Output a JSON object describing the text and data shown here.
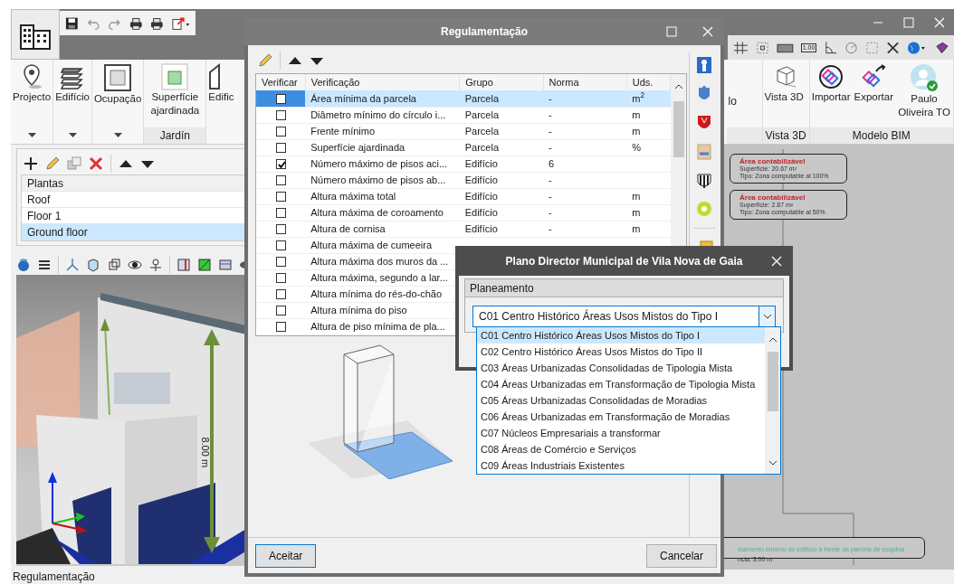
{
  "ribbon": {
    "left_buttons": [
      {
        "label": "Projecto",
        "kind": "dropdown"
      },
      {
        "label": "Edifício",
        "kind": "dropdown"
      },
      {
        "label": "Ocupação",
        "kind": "dropdown"
      },
      {
        "label": "Superfície ajardinada",
        "kind": "grouped",
        "group": "Jardín"
      },
      {
        "label": "Edific",
        "kind": "plain"
      }
    ],
    "partial_label": "lo",
    "right_groups": [
      {
        "label": "Vista 3D",
        "buttons": [
          {
            "label": "Vista 3D"
          }
        ]
      },
      {
        "label": "Modelo BIM",
        "buttons": [
          {
            "label": "Importar"
          },
          {
            "label": "Exportar"
          },
          {
            "label": "Paulo Oliveira TO"
          }
        ]
      }
    ]
  },
  "view_toolbar": {
    "scale_label": "1.00"
  },
  "plantas": {
    "header": "Plantas",
    "rows": [
      {
        "label": "Roof",
        "selected": false
      },
      {
        "label": "Floor 1",
        "selected": false
      },
      {
        "label": "Ground floor",
        "selected": true
      }
    ]
  },
  "viewport": {
    "dimension_label": "8.00 m"
  },
  "canvas": {
    "annotations": [
      {
        "title": "Área contabilizável",
        "lines": [
          "Superfície: 20.67 m²",
          "Tipo: Zona computable al 100%"
        ]
      },
      {
        "title": "Área contabilizável",
        "lines": [
          "Superfície: 2.87 m²",
          "Tipo: Zona computable al 50%"
        ]
      }
    ],
    "bottom_note": {
      "title": "stamento mínimo do edifício à frente da parcela de esquina",
      "detail": "ncia: 3.00 m"
    }
  },
  "status_bar": "Regulamentação",
  "regulamentacao": {
    "title": "Regulamentação",
    "columns": [
      "Verificar",
      "Verificação",
      "Grupo",
      "Norma",
      "Uds."
    ],
    "rows": [
      {
        "checked": false,
        "selected": true,
        "verificacao": "Área mínima da parcela",
        "grupo": "Parcela",
        "norma": "-",
        "uds": "m$^{2}$"
      },
      {
        "checked": false,
        "selected": false,
        "verificacao": "Diâmetro mínimo do círculo i...",
        "grupo": "Parcela",
        "norma": "-",
        "uds": "m"
      },
      {
        "checked": false,
        "selected": false,
        "verificacao": "Frente mínimo",
        "grupo": "Parcela",
        "norma": "-",
        "uds": "m"
      },
      {
        "checked": false,
        "selected": false,
        "verificacao": "Superfície ajardinada",
        "grupo": "Parcela",
        "norma": "-",
        "uds": "%"
      },
      {
        "checked": true,
        "selected": false,
        "verificacao": "Número máximo de pisos aci...",
        "grupo": "Edifício",
        "norma": "6"
      },
      {
        "checked": false,
        "selected": false,
        "verificacao": "Número máximo de pisos ab...",
        "grupo": "Edifício",
        "norma": "-"
      },
      {
        "checked": false,
        "selected": false,
        "verificacao": "Altura máxima total",
        "grupo": "Edifício",
        "norma": "-",
        "uds": "m"
      },
      {
        "checked": false,
        "selected": false,
        "verificacao": "Altura máxima de coroamento",
        "grupo": "Edifício",
        "norma": "-",
        "uds": "m"
      },
      {
        "checked": false,
        "selected": false,
        "verificacao": "Altura de cornisa",
        "grupo": "Edifício",
        "norma": "-",
        "uds": "m"
      },
      {
        "checked": false,
        "selected": false,
        "verificacao": "Altura máxima de cumeeira"
      },
      {
        "checked": false,
        "selected": false,
        "verificacao": "Altura máxima dos muros da ..."
      },
      {
        "checked": false,
        "selected": false,
        "verificacao": "Altura máxima, segundo a lar..."
      },
      {
        "checked": false,
        "selected": false,
        "verificacao": "Altura mínima do rés-do-chão"
      },
      {
        "checked": false,
        "selected": false,
        "verificacao": "Altura mínima do piso"
      },
      {
        "checked": false,
        "selected": false,
        "verificacao": "Altura de piso mínima de pla..."
      }
    ],
    "buttons": [
      "Aceitar",
      "Cancelar"
    ]
  },
  "plano": {
    "title": "Plano Director Municipal de Vila Nova de Gaia",
    "group": "Planeamento",
    "value": "C01 Centro Histórico Áreas Usos Mistos do Tipo I",
    "options": [
      {
        "label": "C01 Centro Histórico Áreas Usos Mistos do Tipo I",
        "selected": true
      },
      {
        "label": "C02 Centro Histórico Áreas Usos Mistos do Tipo II",
        "selected": false
      },
      {
        "label": "C03 Áreas Urbanizadas Consolidadas de Tipologia Mista",
        "selected": false
      },
      {
        "label": "C04 Áreas Urbanizadas em Transformação de Tipologia Mista",
        "selected": false
      },
      {
        "label": "C05 Áreas Urbanizadas Consolidadas de Moradias",
        "selected": false
      },
      {
        "label": "C06 Áreas Urbanizadas em Transformação de Moradias",
        "selected": false
      },
      {
        "label": "C07 Núcleos Empresariais a transformar",
        "selected": false
      },
      {
        "label": "C08 Áreas de Comércio e Serviços",
        "selected": false
      },
      {
        "label": "C09 Áreas Industriais Existentes",
        "selected": false
      }
    ]
  }
}
